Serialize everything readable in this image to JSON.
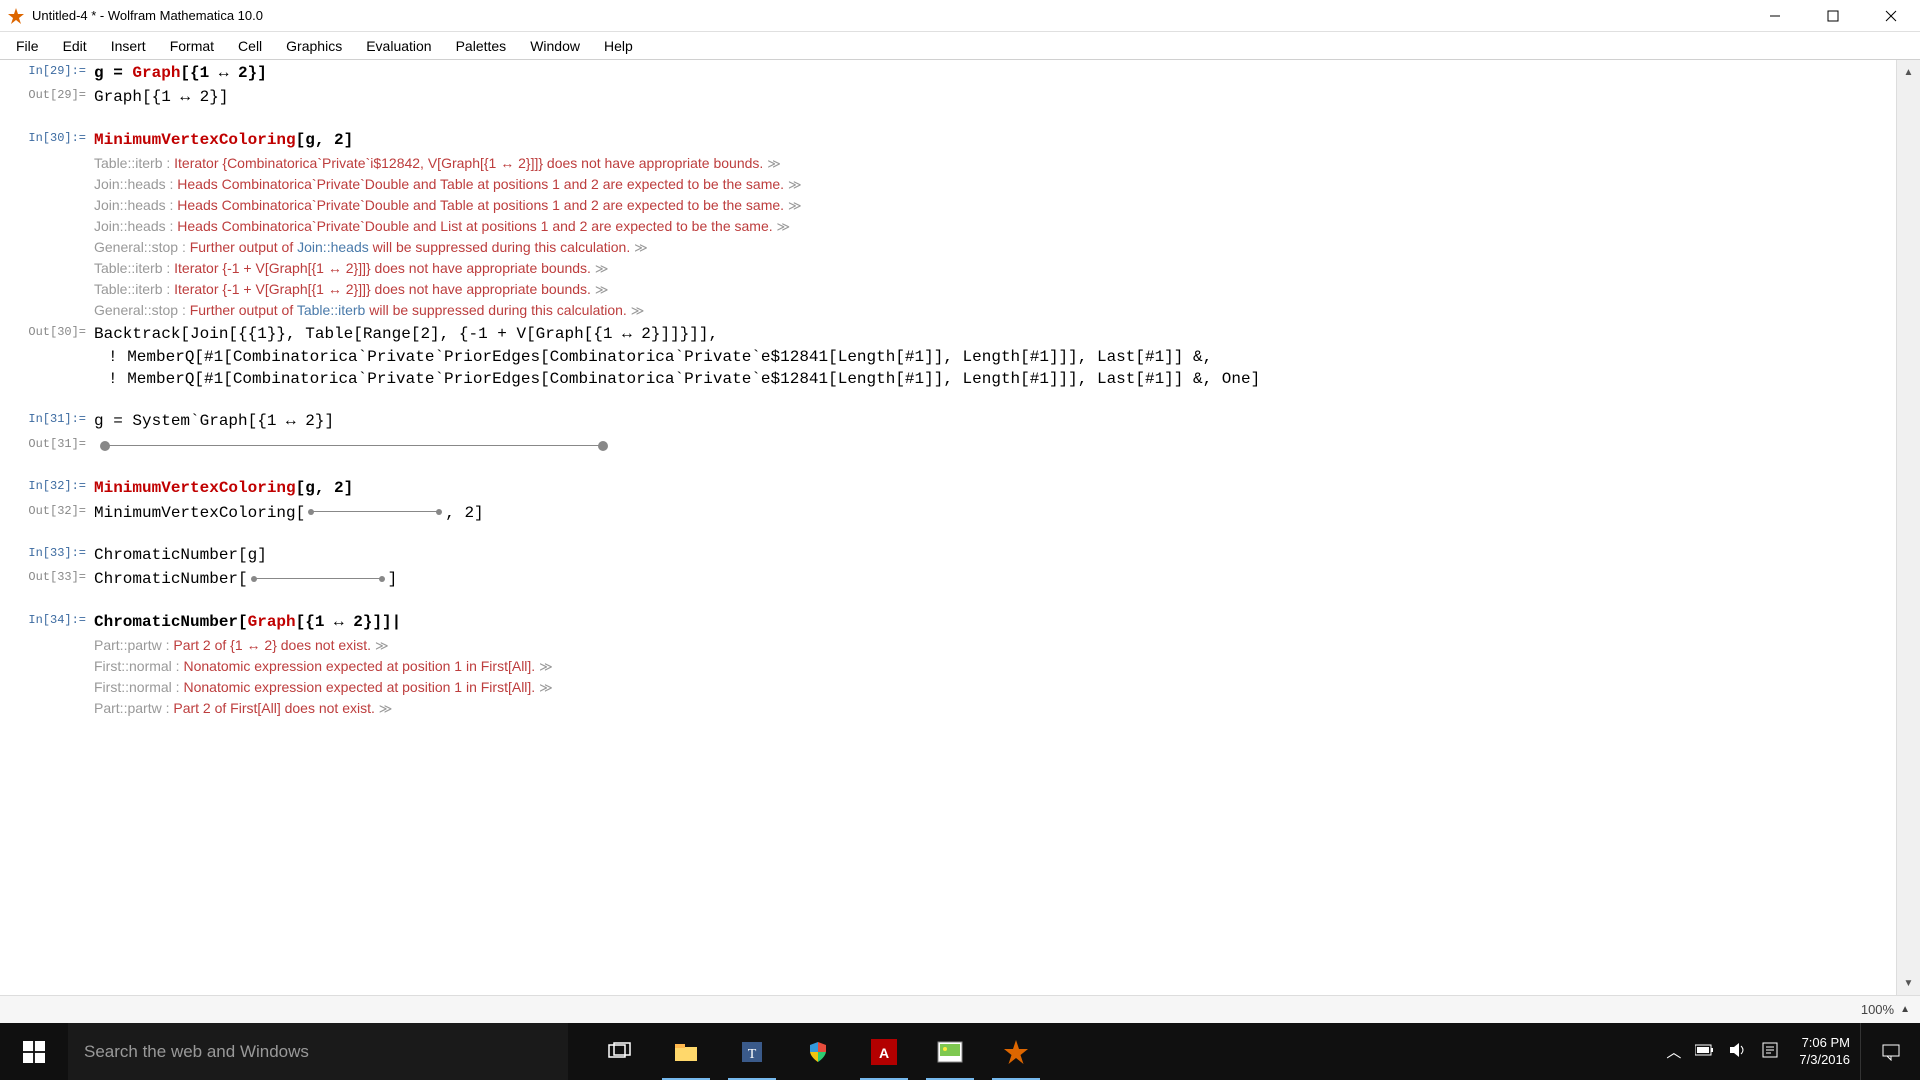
{
  "window": {
    "title": "Untitled-4 * - Wolfram Mathematica 10.0"
  },
  "menus": [
    "File",
    "Edit",
    "Insert",
    "Format",
    "Cell",
    "Graphics",
    "Evaluation",
    "Palettes",
    "Window",
    "Help"
  ],
  "cells": {
    "in29_label": "In[29]:=",
    "in29": "g = ",
    "in29_fn": "Graph",
    "in29_rest": "[{1 ↔ 2}]",
    "out29_label": "Out[29]=",
    "out29": "Graph[{1 ↔ 2}]",
    "in30_label": "In[30]:=",
    "in30_fn": "MinimumVertexColoring",
    "in30_rest": "[g, 2]",
    "msgs30": [
      {
        "tag": "Table::iterb : ",
        "text": "Iterator {Combinatorica`Private`i$12842, V[Graph[{1 ↔ 2}]]} does not have appropriate bounds. ",
        "more": "≫"
      },
      {
        "tag": "Join::heads : ",
        "text": "Heads Combinatorica`Private`Double and Table at positions 1 and 2 are expected to be the same. ",
        "more": "≫"
      },
      {
        "tag": "Join::heads : ",
        "text": "Heads Combinatorica`Private`Double and Table at positions 1 and 2 are expected to be the same. ",
        "more": "≫"
      },
      {
        "tag": "Join::heads : ",
        "text": "Heads Combinatorica`Private`Double and List at positions 1 and 2 are expected to be the same. ",
        "more": "≫"
      },
      {
        "tag": "General::stop : ",
        "pre": "Further output of ",
        "blue": "Join::heads",
        "post": " will be suppressed during this calculation. ",
        "more": "≫"
      },
      {
        "tag": "Table::iterb : ",
        "text": "Iterator {-1 + V[Graph[{1 ↔ 2}]]} does not have appropriate bounds. ",
        "more": "≫"
      },
      {
        "tag": "Table::iterb : ",
        "text": "Iterator {-1 + V[Graph[{1 ↔ 2}]]} does not have appropriate bounds. ",
        "more": "≫"
      },
      {
        "tag": "General::stop : ",
        "pre": "Further output of ",
        "blue": "Table::iterb",
        "post": " will be suppressed during this calculation. ",
        "more": "≫"
      }
    ],
    "out30_label": "Out[30]=",
    "out30_l1": "Backtrack[Join[{{1}}, Table[Range[2], {-1 + V[Graph[{1 ↔ 2}]]}]],",
    "out30_l2": "! MemberQ[#1[Combinatorica`Private`PriorEdges[Combinatorica`Private`e$12841[Length[#1]], Length[#1]]], Last[#1]] &,",
    "out30_l3": "! MemberQ[#1[Combinatorica`Private`PriorEdges[Combinatorica`Private`e$12841[Length[#1]], Length[#1]]], Last[#1]] &, One]",
    "in31_label": "In[31]:=",
    "in31": "g = System`Graph[{1 ↔ 2}]",
    "out31_label": "Out[31]=",
    "in32_label": "In[32]:=",
    "in32_fn": "MinimumVertexColoring",
    "in32_rest": "[g, 2]",
    "out32_label": "Out[32]=",
    "out32_pre": "MinimumVertexColoring[",
    "out32_post": ", 2]",
    "in33_label": "In[33]:=",
    "in33": "ChromaticNumber[g]",
    "out33_label": "Out[33]=",
    "out33_pre": "ChromaticNumber[",
    "out33_post": "]",
    "in34_label": "In[34]:=",
    "in34_pre": "ChromaticNumber[",
    "in34_fn": "Graph",
    "in34_post": "[{1 ↔ 2}]]|",
    "msgs34": [
      {
        "tag": "Part::partw : ",
        "text": "Part 2 of {1 ↔ 2} does not exist. ",
        "more": "≫"
      },
      {
        "tag": "First::normal : ",
        "text": "Nonatomic expression expected at position 1 in First[All]. ",
        "more": "≫"
      },
      {
        "tag": "First::normal : ",
        "text": "Nonatomic expression expected at position 1 in First[All]. ",
        "more": "≫"
      },
      {
        "tag": "Part::partw : ",
        "text": "Part 2 of First[All] does not exist. ",
        "more": "≫"
      }
    ]
  },
  "status": {
    "zoom": "100%"
  },
  "taskbar": {
    "search_placeholder": "Search the web and Windows",
    "time": "7:06 PM",
    "date": "7/3/2016"
  }
}
